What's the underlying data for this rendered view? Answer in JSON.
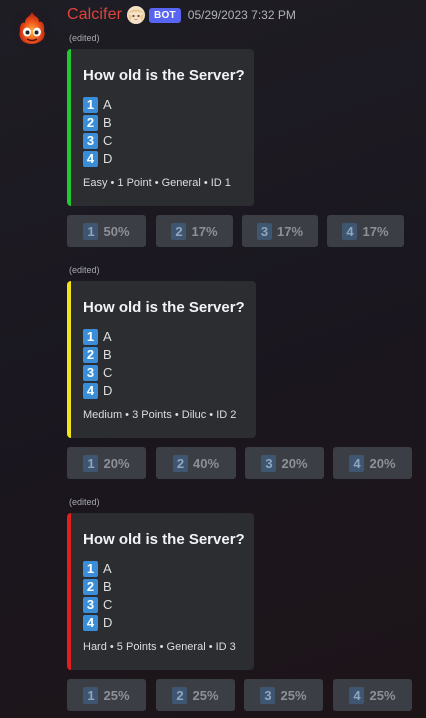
{
  "author": {
    "name": "Calcifer",
    "badge": "BOT",
    "timestamp": "05/29/2023 7:32 PM",
    "avatar_icon": "calcifer-fire-avatar",
    "decoration_icon": "anime-avatar-decoration"
  },
  "colors": {
    "username": "#e0433a",
    "bot_badge": "#5865f2",
    "embed_background": "#2b2d31",
    "option_key": "#3a8ed8",
    "button_background": "#3c3e45"
  },
  "messages": [
    {
      "edited_label": "(edited)",
      "accent_color": "#22c832",
      "title": "How old is the Server?",
      "options": [
        {
          "key": "1",
          "label": "A"
        },
        {
          "key": "2",
          "label": "B"
        },
        {
          "key": "3",
          "label": "C"
        },
        {
          "key": "4",
          "label": "D"
        }
      ],
      "footer": "Easy • 1 Point • General • ID 1",
      "buttons": [
        {
          "key": "1",
          "percent": "50%"
        },
        {
          "key": "2",
          "percent": "17%"
        },
        {
          "key": "3",
          "percent": "17%"
        },
        {
          "key": "4",
          "percent": "17%"
        }
      ]
    },
    {
      "edited_label": "(edited)",
      "accent_color": "#f0e21c",
      "title": "How old is the Server?",
      "options": [
        {
          "key": "1",
          "label": "A"
        },
        {
          "key": "2",
          "label": "B"
        },
        {
          "key": "3",
          "label": "C"
        },
        {
          "key": "4",
          "label": "D"
        }
      ],
      "footer": "Medium • 3 Points • Diluc • ID 2",
      "buttons": [
        {
          "key": "1",
          "percent": "20%"
        },
        {
          "key": "2",
          "percent": "40%"
        },
        {
          "key": "3",
          "percent": "20%"
        },
        {
          "key": "4",
          "percent": "20%"
        }
      ]
    },
    {
      "edited_label": "(edited)",
      "accent_color": "#e21f1f",
      "title": "How old is the Server?",
      "options": [
        {
          "key": "1",
          "label": "A"
        },
        {
          "key": "2",
          "label": "B"
        },
        {
          "key": "3",
          "label": "C"
        },
        {
          "key": "4",
          "label": "D"
        }
      ],
      "footer": "Hard • 5 Points • General • ID 3",
      "buttons": [
        {
          "key": "1",
          "percent": "25%"
        },
        {
          "key": "2",
          "percent": "25%"
        },
        {
          "key": "3",
          "percent": "25%"
        },
        {
          "key": "4",
          "percent": "25%"
        }
      ]
    }
  ]
}
